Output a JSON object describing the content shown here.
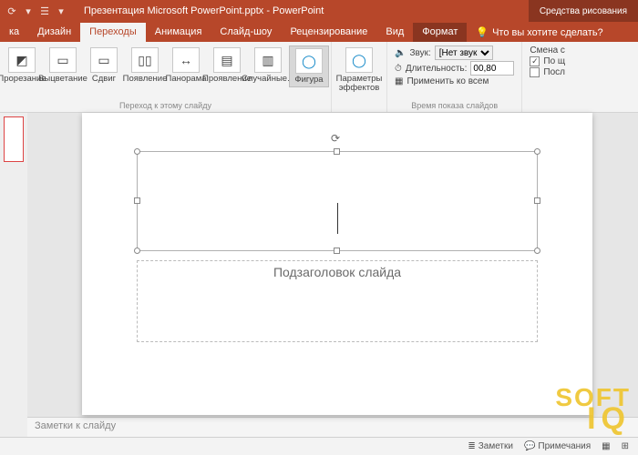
{
  "title": "Презентация Microsoft PowerPoint.pptx - PowerPoint",
  "ctx_tab_group": "Средства рисования",
  "tabs": {
    "t0": "ка",
    "t1": "Дизайн",
    "t2": "Переходы",
    "t3": "Анимация",
    "t4": "Слайд-шоу",
    "t5": "Рецензирование",
    "t6": "Вид",
    "t7": "Формат"
  },
  "tellme": "Что вы хотите сделать?",
  "ribbon": {
    "transitions": {
      "b0": "Прорезание",
      "b1": "Выцветание",
      "b2": "Сдвиг",
      "b3": "Появление",
      "b4": "Панорама",
      "b5": "Проявление",
      "b6": "Случайные...",
      "b7": "Фигура",
      "group_label": "Переход к этому слайду"
    },
    "effects_btn": "Параметры эффектов",
    "timing": {
      "sound_label": "Звук:",
      "sound_value": "[Нет звука]",
      "duration_label": "Длительность:",
      "duration_value": "00,80",
      "apply_all": "Применить ко всем",
      "advance_label": "Смена с",
      "on_click": "По щ",
      "after": "Посл",
      "group_label": "Время показа слайдов"
    }
  },
  "slide": {
    "subtitle_placeholder": "Подзаголовок слайда"
  },
  "notes_placeholder": "Заметки к слайду",
  "statusbar": {
    "notes": "Заметки",
    "comments": "Примечания"
  },
  "watermark_l1": "SOFT",
  "watermark_l2": "IQ"
}
